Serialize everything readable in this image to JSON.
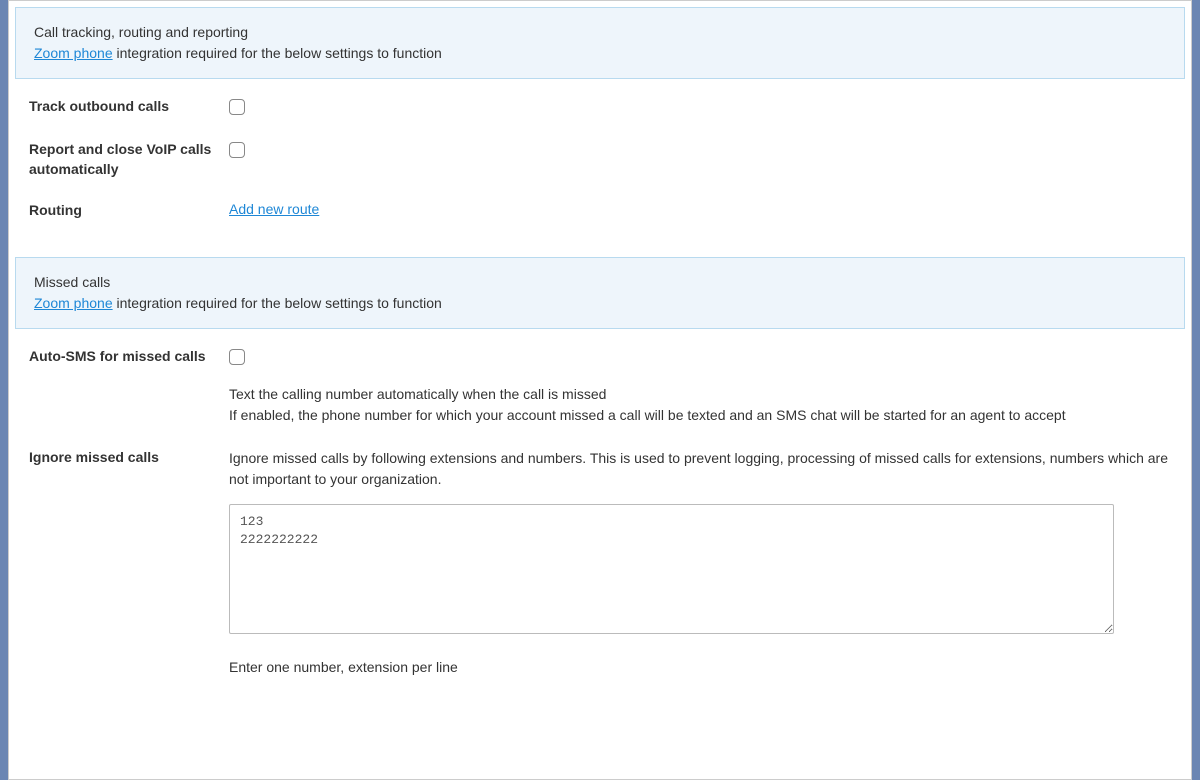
{
  "sections": {
    "call_tracking": {
      "title": "Call tracking, routing and reporting",
      "zoom_link": "Zoom phone",
      "integration_note": " integration required for the below settings to function",
      "fields": {
        "track_outbound": {
          "label": "Track outbound calls",
          "checked": false
        },
        "report_close_voip": {
          "label": "Report and close VoIP calls automatically",
          "checked": false
        },
        "routing": {
          "label": "Routing",
          "link_text": "Add new route"
        }
      }
    },
    "missed_calls": {
      "title": "Missed calls",
      "zoom_link": "Zoom phone",
      "integration_note": " integration required for the below settings to function",
      "fields": {
        "auto_sms": {
          "label": "Auto-SMS for missed calls",
          "checked": false,
          "helper1": "Text the calling number automatically when the call is missed",
          "helper2": "If enabled, the phone number for which your account missed a call will be texted and an SMS chat will be started for an agent to accept"
        },
        "ignore": {
          "label": "Ignore missed calls",
          "helper": "Ignore missed calls by following extensions and numbers. This is used to prevent logging, processing of missed calls for extensions, numbers which are not important to your organization.",
          "value": "123\n2222222222",
          "hint": "Enter one number, extension per line"
        }
      }
    }
  }
}
